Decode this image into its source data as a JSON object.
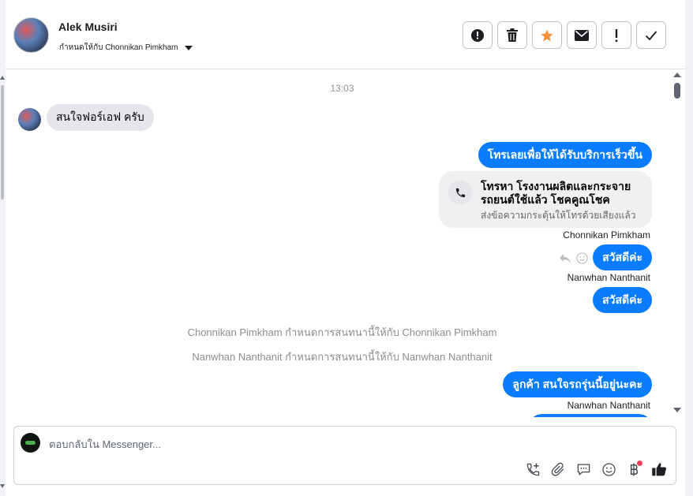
{
  "header": {
    "name": "Alek Musiri",
    "assigned_label": "กำหนดให้กับ Chonnikan Pimkham",
    "actions": [
      {
        "icon": "alert-circle-icon",
        "label": "Mark as spam"
      },
      {
        "icon": "trash-icon",
        "label": "Delete"
      },
      {
        "icon": "star-icon",
        "label": "Star"
      },
      {
        "icon": "envelope-icon",
        "label": "Mark unread"
      },
      {
        "icon": "exclamation-icon",
        "label": "Follow up"
      },
      {
        "icon": "check-icon",
        "label": "Done"
      }
    ]
  },
  "thread": {
    "timestamp": "13:03",
    "incoming": {
      "text": "สนใจฟอร์เอฟ ครับ"
    },
    "outgoing_1": "โทรเลยเพื่อให้ได้รับบริการเร็วขึ้น",
    "call_card": {
      "title": "โทรหา โรงงานผลิตและกระจาย รถยนต์ใช้แล้ว โชคคูณโชค",
      "subtitle": "ส่งข้อความกระตุ้นให้โทรด้วยเสียงแล้ว"
    },
    "sender_1": "Chonnikan Pimkham",
    "outgoing_2": "สวัสดีค่ะ",
    "sender_2": "Nanwhan Nanthanit",
    "outgoing_3": "สวัสดีค่ะ",
    "system_1": "Chonnikan Pimkham กำหนดการสนทนานี้ให้กับ Chonnikan Pimkham",
    "system_2": "Nanwhan Nanthanit กำหนดการสนทนานี้ให้กับ Nanwhan Nanthanit",
    "outgoing_4": "ลูกค้า สนใจรถรุ่นนี้อยู่นะคะ",
    "sender_3": "Nanwhan Nanthanit"
  },
  "composer": {
    "placeholder": "ตอบกลับใน Messenger...",
    "tools": [
      "add-call-icon",
      "paperclip-icon",
      "saved-reply-icon",
      "emoji-icon",
      "baht-icon",
      "thumbs-up-icon"
    ]
  },
  "colors": {
    "accent": "#0a7cff",
    "star": "#f7923a",
    "notification_dot": "#f3425f"
  }
}
